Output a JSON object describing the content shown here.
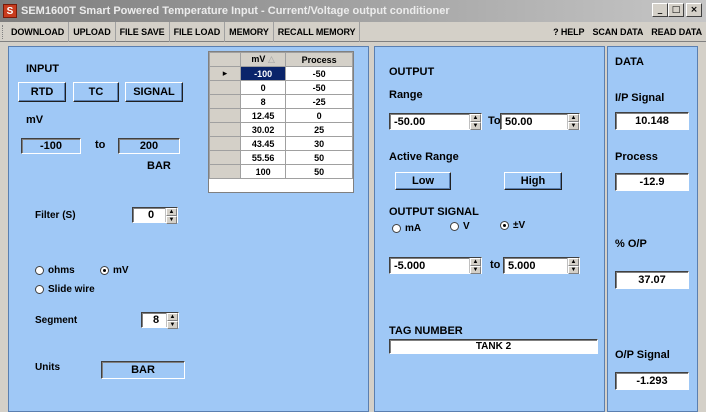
{
  "window": {
    "app_icon": "S",
    "title": "SEM1600T Smart Powered Temperature Input - Current/Voltage output conditioner",
    "minimize": "_",
    "maximize": "□",
    "close": "×"
  },
  "menu": {
    "left": [
      "DOWNLOAD",
      "UPLOAD",
      "FILE SAVE",
      "FILE LOAD",
      "MEMORY",
      "RECALL MEMORY"
    ],
    "right": [
      "? HELP",
      "SCAN DATA",
      "READ DATA"
    ]
  },
  "input": {
    "title": "INPUT",
    "type_buttons": [
      "RTD",
      "TC",
      "SIGNAL"
    ],
    "unit_label": "mV",
    "range_low": "-100",
    "range_to": "to",
    "range_high": "200",
    "eng_unit": "BAR",
    "filter_label": "Filter (S)",
    "filter_value": "0",
    "options": {
      "ohms": "ohms",
      "mv": "mV",
      "slide_wire": "Slide wire",
      "selected": "mV"
    },
    "segment_label": "Segment",
    "segment_value": "8",
    "units_label": "Units",
    "units_value": "BAR"
  },
  "table": {
    "col_mv": "mV",
    "col_process": "Process",
    "sort_icon": "sort-up-icon",
    "row_marker": "▸",
    "rows": [
      {
        "mv": "-100",
        "process": "-50"
      },
      {
        "mv": "0",
        "process": "-50"
      },
      {
        "mv": "8",
        "process": "-25"
      },
      {
        "mv": "12.45",
        "process": "0"
      },
      {
        "mv": "30.02",
        "process": "25"
      },
      {
        "mv": "43.45",
        "process": "30"
      },
      {
        "mv": "55.56",
        "process": "50"
      },
      {
        "mv": "100",
        "process": "50"
      }
    ]
  },
  "output": {
    "title": "OUTPUT",
    "range_label": "Range",
    "range_low": "-50.00",
    "range_to": "To",
    "range_high": "50.00",
    "active_range_label": "Active Range",
    "low_button": "Low",
    "high_button": "High",
    "signal_label": "OUTPUT SIGNAL",
    "signal_options": {
      "ma": "mA",
      "v": "V",
      "pmv": "±V",
      "selected": "±V"
    },
    "signal_low": "-5.000",
    "signal_to": "to",
    "signal_high": "5.000",
    "tag_label": "TAG NUMBER",
    "tag_value": "TANK 2"
  },
  "data": {
    "title": "DATA",
    "ip_signal_label": "I/P Signal",
    "ip_signal_value": "10.148",
    "process_label": "Process",
    "process_value": "-12.9",
    "pct_op_label": "% O/P",
    "pct_op_value": "37.07",
    "op_signal_label": "O/P Signal",
    "op_signal_value": "-1.293"
  }
}
